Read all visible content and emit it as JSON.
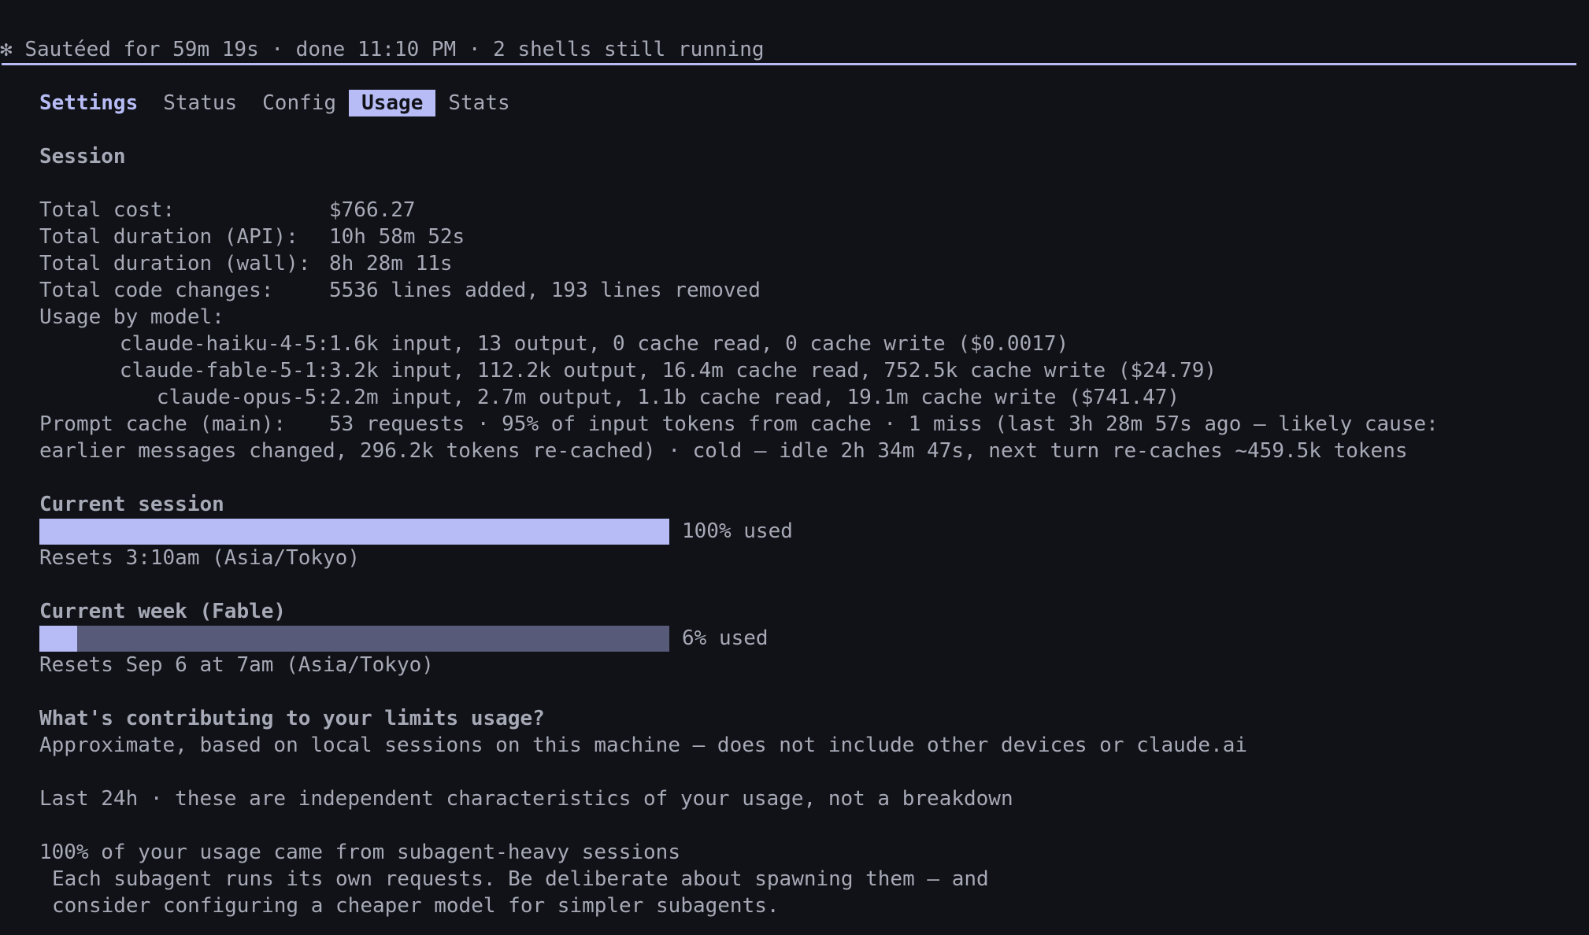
{
  "status_line": {
    "spinner": "✻",
    "text": "Sautéed for 59m 19s · done 11:10 PM · 2 shells still running"
  },
  "tabs": {
    "title": "Settings",
    "items": [
      {
        "label": "Status",
        "selected": false
      },
      {
        "label": "Config",
        "selected": false
      },
      {
        "label": "Usage",
        "selected": true
      },
      {
        "label": "Stats",
        "selected": false
      }
    ]
  },
  "session": {
    "heading": "Session",
    "total_cost": {
      "label": "Total cost:",
      "value": "$766.27"
    },
    "duration_api": {
      "label": "Total duration (API):",
      "value": "10h 58m 52s"
    },
    "duration_wall": {
      "label": "Total duration (wall):",
      "value": "8h 28m 11s"
    },
    "code_changes": {
      "label": "Total code changes:",
      "value": "5536 lines added, 193 lines removed"
    },
    "usage_by_model_label": "Usage by model:",
    "models": [
      {
        "name": "claude-haiku-4-5:",
        "value": "1.6k input, 13 output, 0 cache read, 0 cache write ($0.0017)"
      },
      {
        "name": "claude-fable-5-1:",
        "value": "3.2k input, 112.2k output, 16.4m cache read, 752.5k cache write ($24.79)"
      },
      {
        "name": "claude-opus-5:",
        "value": "2.2m input, 2.7m output, 1.1b cache read, 19.1m cache write ($741.47)"
      }
    ],
    "prompt_cache": {
      "label": "Prompt cache (main):",
      "value_line1": "53 requests · 95% of input tokens from cache · 1 miss (last 3h 28m 57s ago — likely cause:",
      "value_line2": "earlier messages changed, 296.2k tokens re-cached) · cold — idle 2h 34m 47s, next turn re-caches ~459.5k tokens"
    }
  },
  "limits": {
    "current_session": {
      "heading": "Current session",
      "percent": 100,
      "used_label": "100% used",
      "resets": "Resets 3:10am (Asia/Tokyo)"
    },
    "current_week": {
      "heading": "Current week (Fable)",
      "percent": 6,
      "used_label": "6% used",
      "resets": "Resets Sep 6 at 7am (Asia/Tokyo)"
    }
  },
  "contributions": {
    "heading": "What's contributing to your limits usage?",
    "subtitle": "Approximate, based on local sessions on this machine — does not include other devices or claude.ai",
    "period_note": "Last 24h · these are independent characteristics of your usage, not a breakdown",
    "insight_title": "100% of your usage came from subagent-heavy sessions",
    "insight_line1": "Each subagent runs its own requests. Be deliberate about spawning them — and",
    "insight_line2": "consider configuring a cheaper model for simpler subagents."
  },
  "colors": {
    "background": "#111217",
    "text": "#a6a9b6",
    "accent": "#b7bcf6",
    "bar_track": "#575a78"
  }
}
